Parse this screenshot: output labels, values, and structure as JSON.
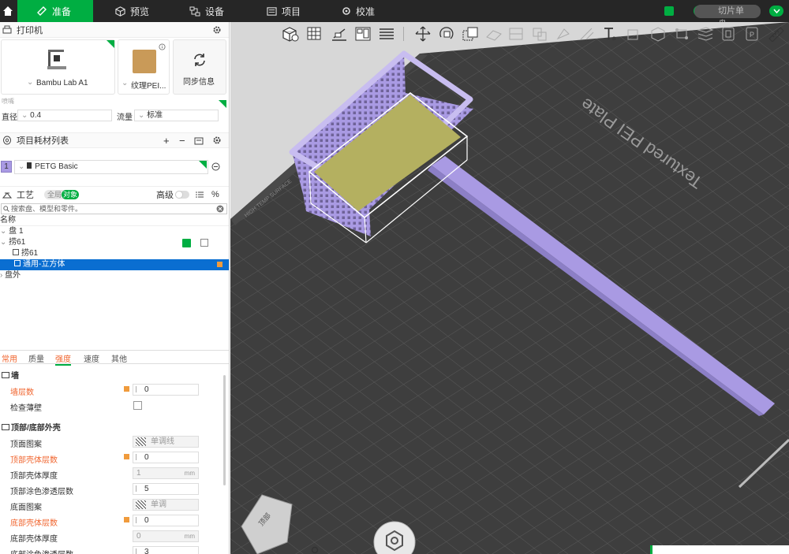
{
  "topbar": {
    "tabs": [
      {
        "label": "准备",
        "icon": "prepare-icon"
      },
      {
        "label": "预览",
        "icon": "cube-icon"
      },
      {
        "label": "设备",
        "icon": "device-icon"
      },
      {
        "label": "项目",
        "icon": "project-icon"
      },
      {
        "label": "校准",
        "icon": "calibration-icon"
      }
    ],
    "slice_label": "切片单盘"
  },
  "printer": {
    "section_title": "打印机",
    "name": "Bambu Lab A1",
    "plate": "纹理PEI...",
    "sync_label": "同步信息",
    "nozzle_group": "喷嘴",
    "diameter_label": "直径",
    "diameter_value": "0.4",
    "flow_label": "流量",
    "flow_value": "标准"
  },
  "filament": {
    "section_title": "项目耗材列表",
    "slot": "1",
    "name": "PETG Basic"
  },
  "process": {
    "section_title": "工艺",
    "toggle_global": "全局",
    "toggle_object": "对象",
    "advanced_label": "高级",
    "search_placeholder": "搜索盘、模型和零件。"
  },
  "tree": {
    "header": "名称",
    "rows": [
      "盘 1",
      "捞61",
      "捞61",
      "通用-立方体",
      "盘外"
    ]
  },
  "settings_tabs": [
    "常用",
    "质量",
    "强度",
    "速度",
    "其他"
  ],
  "wall": {
    "title": "墙",
    "wall_loops_label": "墙层数",
    "wall_loops_value": "0",
    "detect_thin_label": "检查薄壁"
  },
  "shell": {
    "title": "顶部/底部外壳",
    "top_pattern_label": "顶面图案",
    "top_pattern_value": "单调线",
    "top_layers_label": "顶部壳体层数",
    "top_layers_value": "0",
    "top_thickness_label": "顶部壳体厚度",
    "top_thickness_value": "1",
    "top_paint_label": "顶部涂色渗透层数",
    "top_paint_value": "5",
    "bottom_pattern_label": "底面图案",
    "bottom_pattern_value": "单调",
    "bottom_layers_label": "底部壳体层数",
    "bottom_layers_value": "0",
    "bottom_thickness_label": "底部壳体厚度",
    "bottom_thickness_value": "0",
    "bottom_paint_label": "底部涂色渗透层数",
    "bottom_paint_value": "3",
    "unit_mm": "mm"
  },
  "viewport": {
    "plate_text": "Textured PEI Plate",
    "surface_label": "HIGH TEMP SURFACE",
    "navcube_label": "顶部",
    "colors": {
      "model": "#a99ae3",
      "highlight": "#b4b060",
      "bed": "#3e3e3e",
      "grid": "#5a5a5a"
    }
  }
}
